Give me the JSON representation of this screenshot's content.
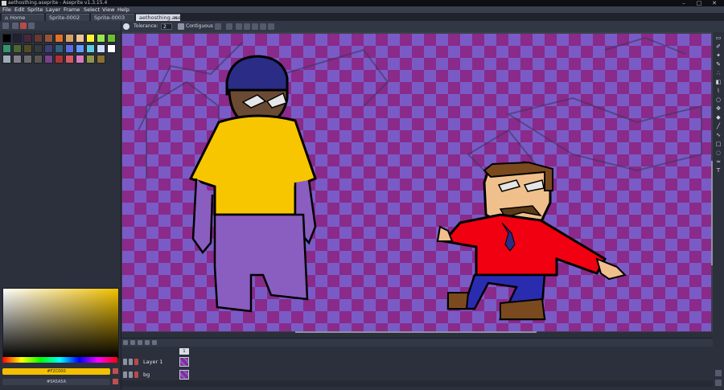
{
  "window": {
    "title": "aethosthing.aseprite - Aseprite v1.3.15.4",
    "minimize": "–",
    "maximize": "□",
    "close": "✕"
  },
  "menu": [
    "File",
    "Edit",
    "Sprite",
    "Layer",
    "Frame",
    "Select",
    "View",
    "Help"
  ],
  "tabs": [
    {
      "label": "Home",
      "active": false
    },
    {
      "label": "Sprite-0002",
      "active": false
    },
    {
      "label": "Sprite-0003",
      "active": false
    },
    {
      "label": "aethosthing.ase",
      "active": true,
      "close": "×"
    }
  ],
  "context_bar": {
    "tolerance_label": "Tolerance:",
    "tolerance_value": "2",
    "contiguous_label": "Contiguous"
  },
  "palette_colors": [
    "#000000",
    "#222034",
    "#45283c",
    "#663931",
    "#8f563b",
    "#df7126",
    "#d9a066",
    "#eec39a",
    "#fbf236",
    "#99e550",
    "#6abe30",
    "#37946e",
    "#4b692f",
    "#524b24",
    "#323c39",
    "#3f3f74",
    "#306082",
    "#5b6ee1",
    "#639bff",
    "#5fcde4",
    "#cbdbfc",
    "#ffffff",
    "#9badb7",
    "#847e87",
    "#696a6a",
    "#595652",
    "#76428a",
    "#ac3232",
    "#d95763",
    "#d77bba",
    "#8f974a",
    "#8a6f30"
  ],
  "colors": {
    "foreground": "#f2c000",
    "background": "#5a5a5a",
    "foreground_label": "#F2C000",
    "background_label": "#5A5A5A"
  },
  "layers": [
    {
      "name": "Layer 1"
    },
    {
      "name": "bg"
    }
  ],
  "timeline": {
    "frame_number": "1"
  }
}
